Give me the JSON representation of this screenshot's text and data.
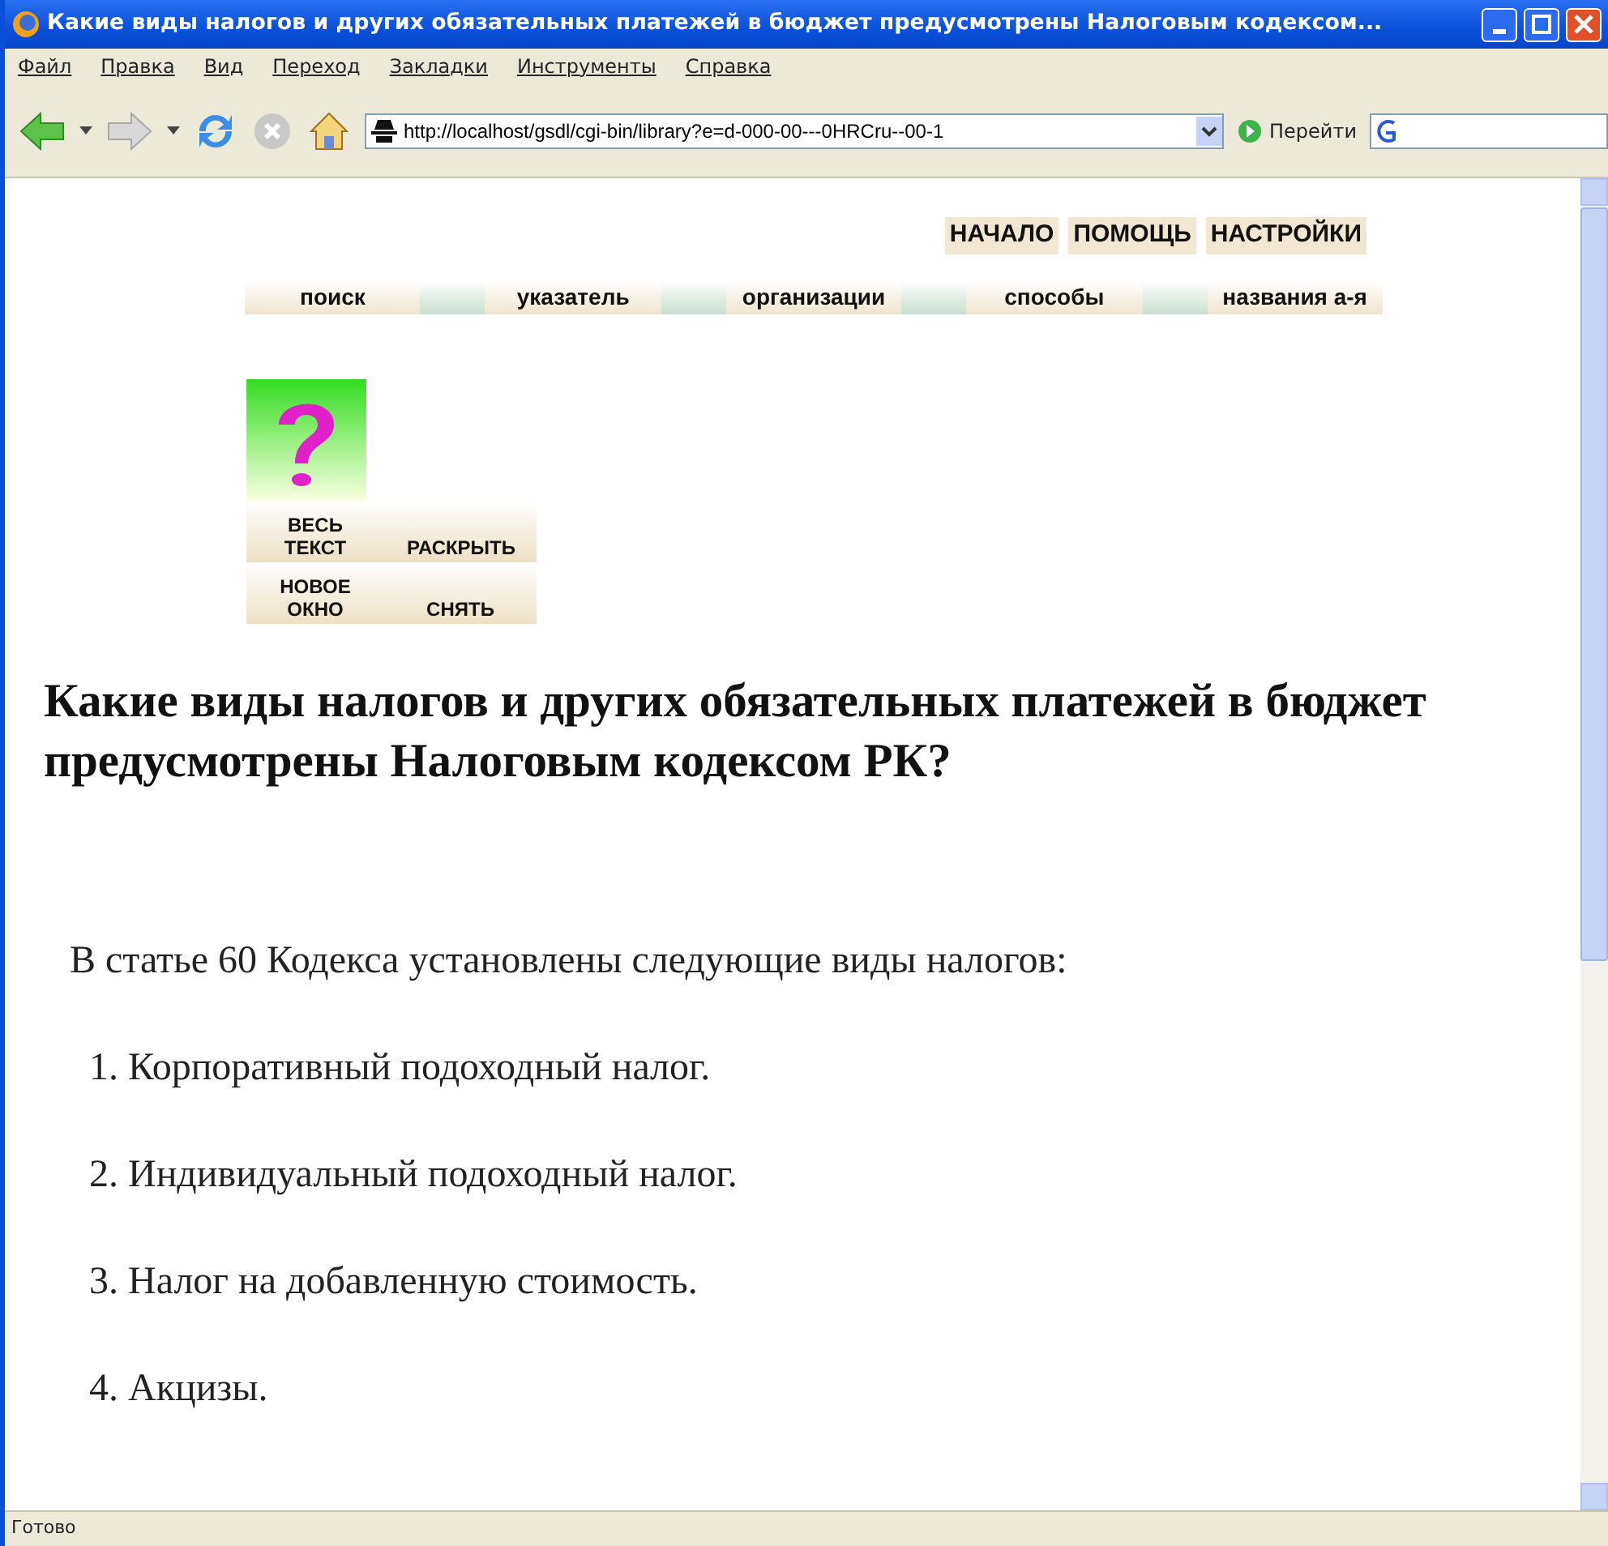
{
  "window": {
    "title": "Какие виды налогов и других обязательных платежей в бюджет предусмотрены Налоговым кодексом..."
  },
  "menu": [
    "Файл",
    "Правка",
    "Вид",
    "Переход",
    "Закладки",
    "Инструменты",
    "Справка"
  ],
  "toolbar": {
    "address": "http://localhost/gsdl/cgi-bin/library?e=d-000-00---0HRCru--00-1",
    "go_label": "Перейти"
  },
  "top_links": [
    "НАЧАЛО",
    "ПОМОЩЬ",
    "НАСТРОЙКИ"
  ],
  "nav_tabs": [
    "поиск",
    "указатель",
    "организации",
    "способы",
    "названия а-я"
  ],
  "doc_buttons": [
    [
      "ВЕСЬ ТЕКСТ",
      "РАСКРЫТЬ"
    ],
    [
      "НОВОЕ ОКНО",
      "СНЯТЬ"
    ]
  ],
  "heading": "Какие виды налогов и других обязательных платежей в бюджет предусмотрены Налоговым кодексом РК?",
  "paragraphs": [
    "В статье 60 Кодекса установлены следующие виды налогов:",
    "1. Корпоративный подоходный налог.",
    "2. Индивидуальный подоходный налог.",
    "3. Налог на добавленную стоимость.",
    "4. Акцизы."
  ],
  "status_bar": "Готово"
}
